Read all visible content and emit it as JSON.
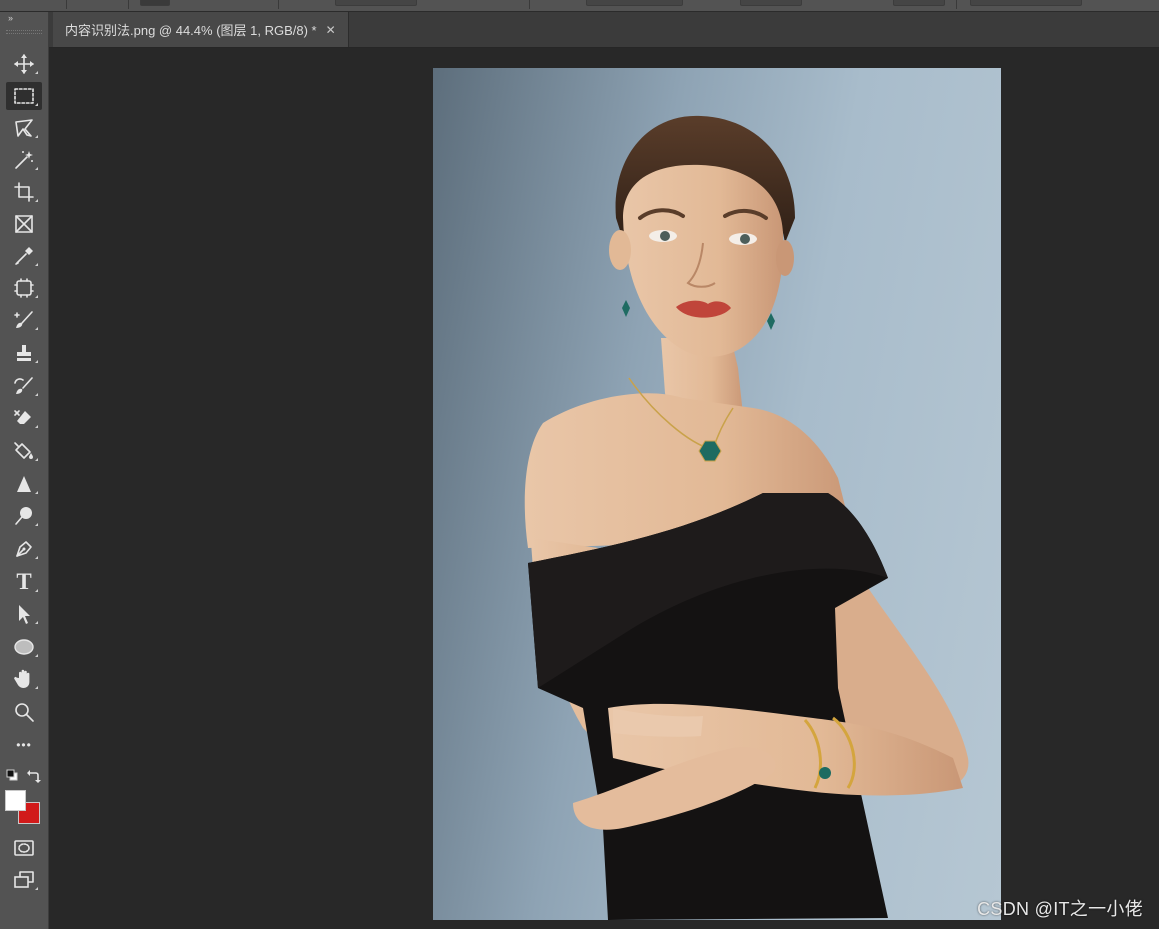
{
  "document_tab": {
    "title": "内容识别法.png @ 44.4% (图层 1, RGB/8) *",
    "close_glyph": "✕"
  },
  "toolbar": {
    "collapse_glyph": "››",
    "tools": [
      {
        "name": "move-tool",
        "icon": "move-icon"
      },
      {
        "name": "rectangular-marquee-tool",
        "icon": "marquee-icon",
        "active": true
      },
      {
        "name": "lasso-tool",
        "icon": "lasso-icon"
      },
      {
        "name": "magic-wand-tool",
        "icon": "magic-wand-icon"
      },
      {
        "name": "crop-tool",
        "icon": "crop-icon"
      },
      {
        "name": "frame-tool",
        "icon": "frame-icon"
      },
      {
        "name": "eyedropper-tool",
        "icon": "eyedropper-icon"
      },
      {
        "name": "spot-healing-tool",
        "icon": "healing-patch-icon"
      },
      {
        "name": "brush-tool",
        "icon": "brush-icon"
      },
      {
        "name": "clone-stamp-tool",
        "icon": "stamp-icon"
      },
      {
        "name": "history-brush-tool",
        "icon": "history-brush-icon"
      },
      {
        "name": "eraser-tool",
        "icon": "eraser-icon"
      },
      {
        "name": "paint-bucket-tool",
        "icon": "paint-bucket-icon"
      },
      {
        "name": "blur-tool",
        "icon": "blur-drop-icon"
      },
      {
        "name": "dodge-tool",
        "icon": "dodge-icon"
      },
      {
        "name": "pen-tool",
        "icon": "pen-icon"
      },
      {
        "name": "type-tool",
        "icon": "type-icon",
        "glyph": "T"
      },
      {
        "name": "path-selection-tool",
        "icon": "arrow-icon"
      },
      {
        "name": "ellipse-tool",
        "icon": "ellipse-icon"
      },
      {
        "name": "hand-tool",
        "icon": "hand-icon"
      },
      {
        "name": "zoom-tool",
        "icon": "zoom-icon"
      },
      {
        "name": "edit-toolbar",
        "icon": "more-icon",
        "glyph": "•••"
      },
      {
        "name": "quick-mask-button",
        "icon": "quick-mask-icon"
      },
      {
        "name": "screen-mode-button",
        "icon": "screen-mode-icon"
      }
    ],
    "colors": {
      "foreground": "#ffffff",
      "background": "#d11a1a"
    }
  },
  "watermark": "CSDN @IT之一小佬",
  "theme": {
    "panel": "#535353",
    "canvas": "#282828",
    "tab_active": "#484848"
  }
}
